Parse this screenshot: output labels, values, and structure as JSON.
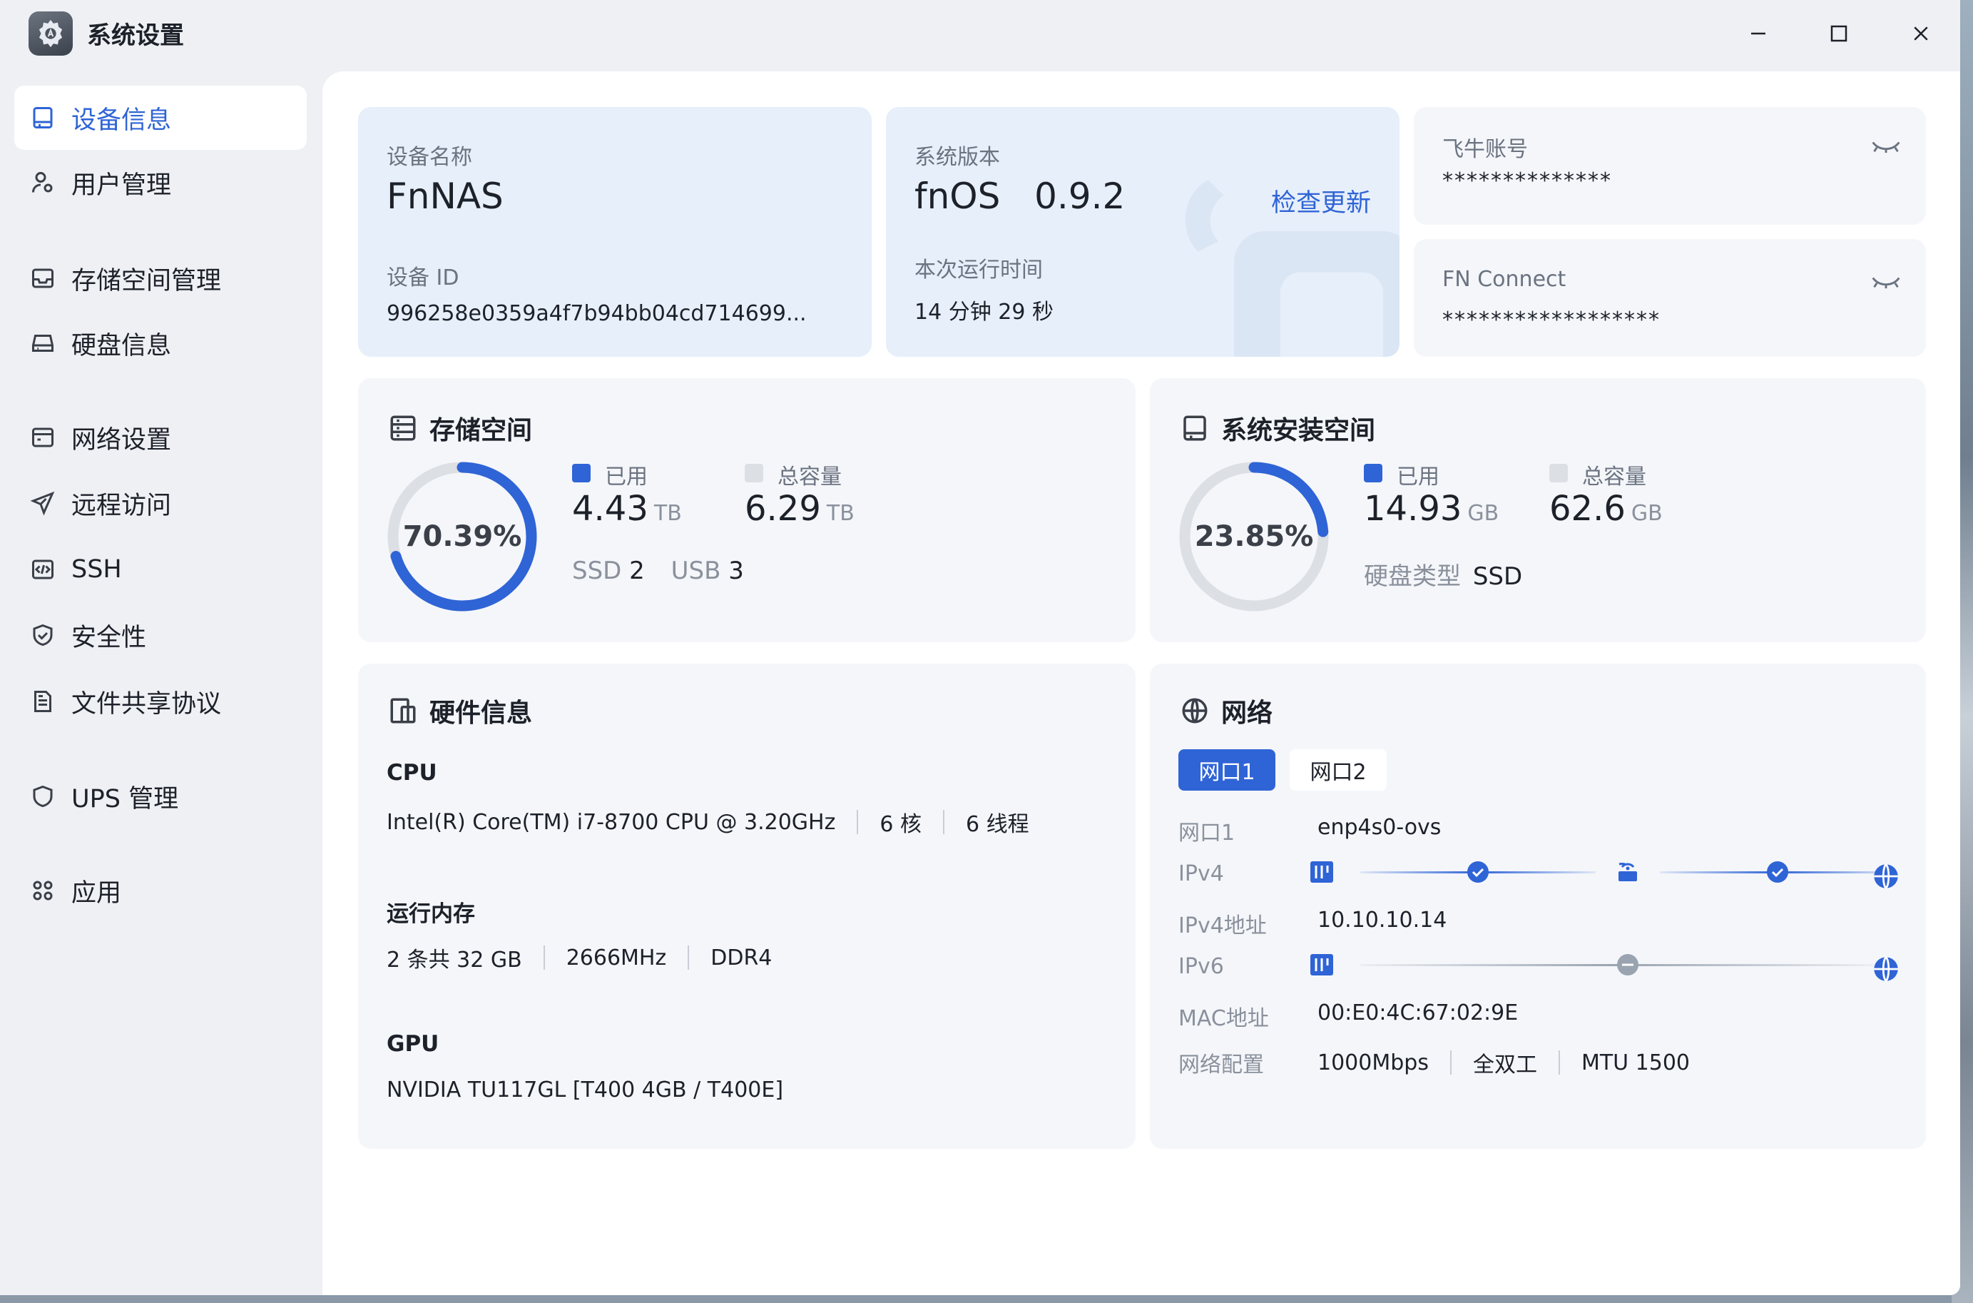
{
  "window": {
    "title": "系统设置"
  },
  "sidebar": {
    "items": [
      {
        "label": "设备信息"
      },
      {
        "label": "用户管理"
      },
      {
        "label": "存储空间管理"
      },
      {
        "label": "硬盘信息"
      },
      {
        "label": "网络设置"
      },
      {
        "label": "远程访问"
      },
      {
        "label": "SSH"
      },
      {
        "label": "安全性"
      },
      {
        "label": "文件共享协议"
      },
      {
        "label": "UPS 管理"
      },
      {
        "label": "应用"
      }
    ]
  },
  "device": {
    "name_label": "设备名称",
    "name": "FnNAS",
    "id_label": "设备 ID",
    "id": "996258e0359a4f7b94bb04cd714699..."
  },
  "system": {
    "version_label": "系统版本",
    "version": "fnOS   0.9.2",
    "check_update": "检查更新",
    "uptime_label": "本次运行时间",
    "uptime": "14 分钟 29 秒"
  },
  "account": {
    "label": "飞牛账号",
    "value": "**************"
  },
  "fnconnect": {
    "label": "FN Connect",
    "value": "******************"
  },
  "storage": {
    "title": "存储空间",
    "percent": "70.39%",
    "fraction": 0.7039,
    "used_label": "已用",
    "used": "4.43",
    "used_unit": "TB",
    "total_label": "总容量",
    "total": "6.29",
    "total_unit": "TB",
    "ssd_label": "SSD",
    "ssd": "2",
    "usb_label": "USB",
    "usb": "3"
  },
  "sysdisk": {
    "title": "系统安装空间",
    "percent": "23.85%",
    "fraction": 0.2385,
    "used_label": "已用",
    "used": "14.93",
    "used_unit": "GB",
    "total_label": "总容量",
    "total": "62.6",
    "total_unit": "GB",
    "type_label": "硬盘类型",
    "type": "SSD"
  },
  "hardware": {
    "title": "硬件信息",
    "cpu_label": "CPU",
    "cpu_model": "Intel(R) Core(TM) i7-8700 CPU @ 3.20GHz",
    "cpu_cores": "6 核",
    "cpu_threads": "6 线程",
    "mem_label": "运行内存",
    "mem_size": "2 条共 32 GB",
    "mem_freq": "2666MHz",
    "mem_type": "DDR4",
    "gpu_label": "GPU",
    "gpu_model": "NVIDIA TU117GL [T400 4GB / T400E]"
  },
  "network": {
    "title": "网络",
    "tabs": [
      "网口1",
      "网口2"
    ],
    "rows": {
      "port_label": "网口1",
      "port": "enp4s0-ovs",
      "ipv4_label": "IPv4",
      "ipv4addr_label": "IPv4地址",
      "ipv4addr": "10.10.10.14",
      "ipv6_label": "IPv6",
      "mac_label": "MAC地址",
      "mac": "00:E0:4C:67:02:9E",
      "config_label": "网络配置",
      "speed": "1000Mbps",
      "duplex": "全双工",
      "mtu": "MTU 1500"
    }
  },
  "colors": {
    "accent": "#2f64d6",
    "track": "#dcdfe4",
    "ok": "#2f64d6",
    "neutral": "#9aa3b0"
  }
}
